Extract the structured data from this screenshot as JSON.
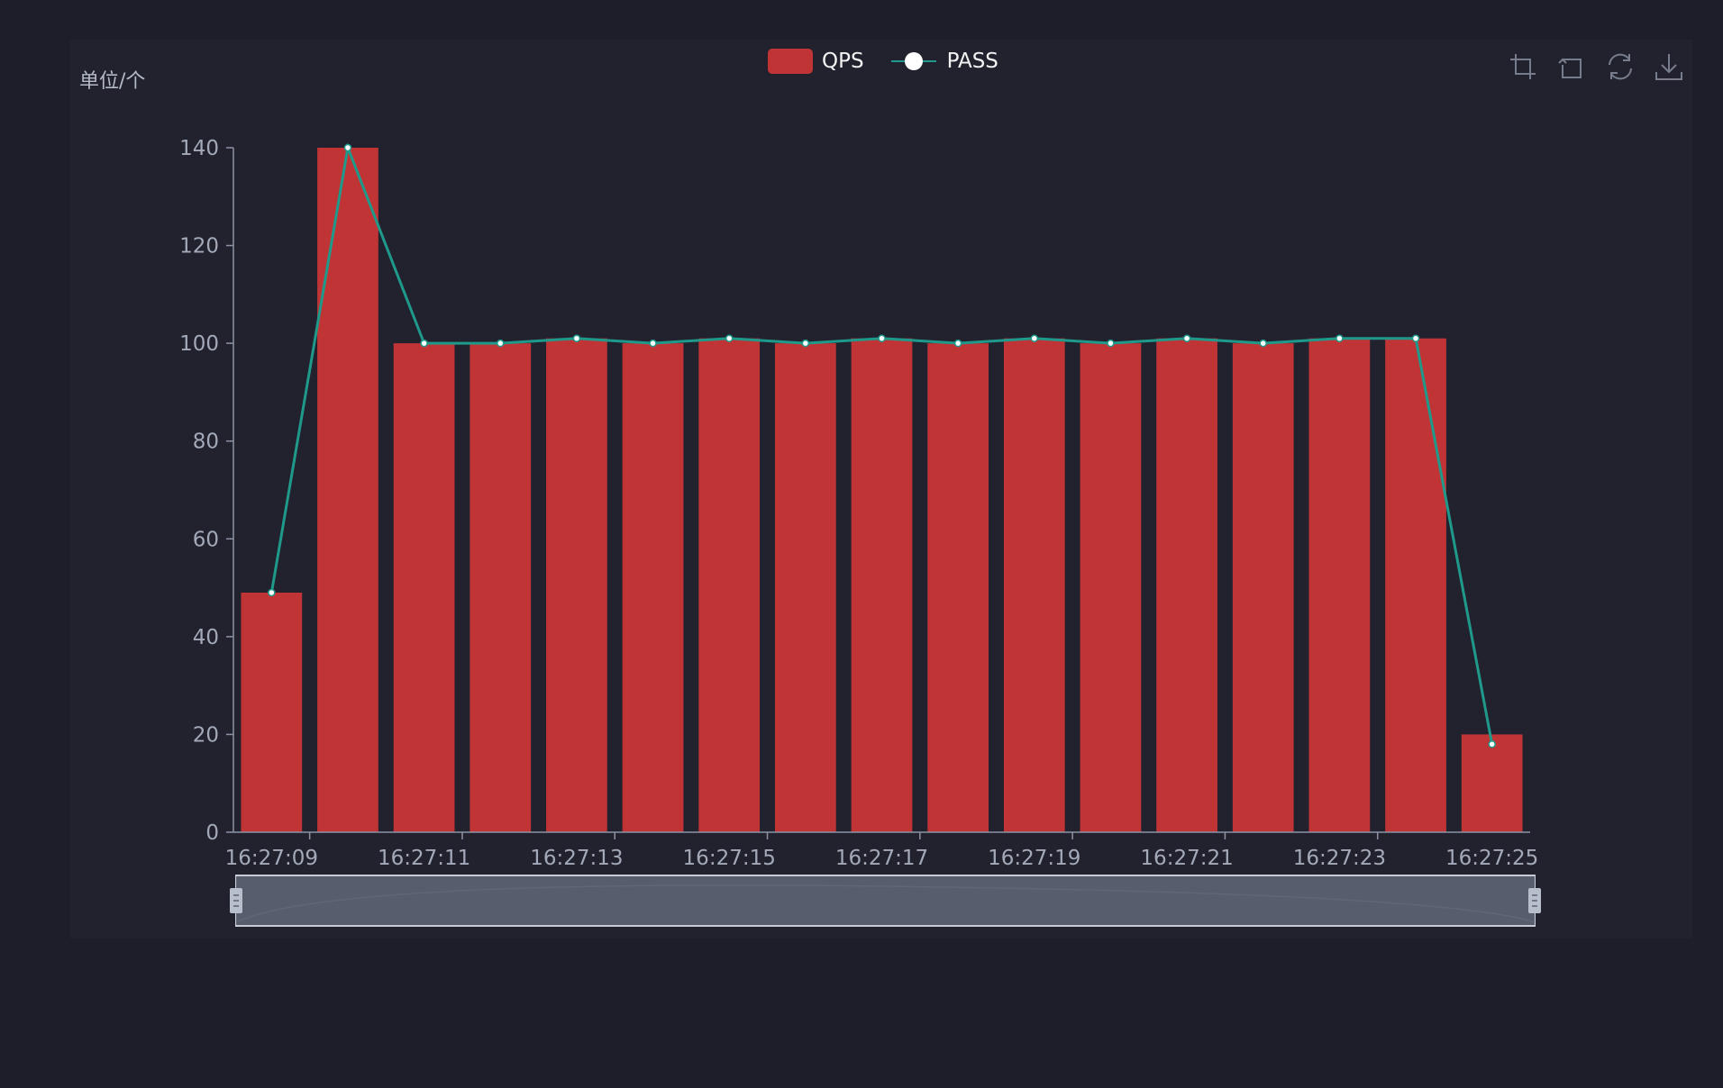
{
  "unit_label": "单位/个",
  "legend": {
    "qps": "QPS",
    "pass": "PASS"
  },
  "toolbox": [
    "zoom-select-icon",
    "zoom-back-icon",
    "restore-icon",
    "save-image-icon"
  ],
  "colors": {
    "background": "#1e1e2a",
    "panel": "#22222f",
    "bar": "#c13436",
    "line": "#1f9a8a",
    "axis": "#8c93a6",
    "tick_text": "#a3a9b8",
    "slider": "#5a6070"
  },
  "chart_data": {
    "type": "bar",
    "categories": [
      "16:27:09",
      "16:27:10",
      "16:27:11",
      "16:27:12",
      "16:27:13",
      "16:27:14",
      "16:27:15",
      "16:27:16",
      "16:27:17",
      "16:27:18",
      "16:27:19",
      "16:27:20",
      "16:27:21",
      "16:27:22",
      "16:27:23",
      "16:27:24",
      "16:27:25"
    ],
    "x_tick_labels": [
      "16:27:09",
      "16:27:11",
      "16:27:13",
      "16:27:15",
      "16:27:17",
      "16:27:19",
      "16:27:21",
      "16:27:23",
      "16:27:25"
    ],
    "series": [
      {
        "name": "QPS",
        "type": "bar",
        "values": [
          49,
          140,
          100,
          100,
          101,
          100,
          101,
          100,
          101,
          100,
          101,
          100,
          101,
          100,
          101,
          101,
          20
        ]
      },
      {
        "name": "PASS",
        "type": "line",
        "values": [
          49,
          140,
          100,
          100,
          101,
          100,
          101,
          100,
          101,
          100,
          101,
          100,
          101,
          100,
          101,
          101,
          18
        ]
      }
    ],
    "ylim": [
      0,
      140
    ],
    "yticks": [
      0,
      20,
      40,
      60,
      80,
      100,
      120,
      140
    ],
    "grid": false,
    "legend_position": "top-center",
    "data_zoom": {
      "start": 0,
      "end": 100
    }
  }
}
